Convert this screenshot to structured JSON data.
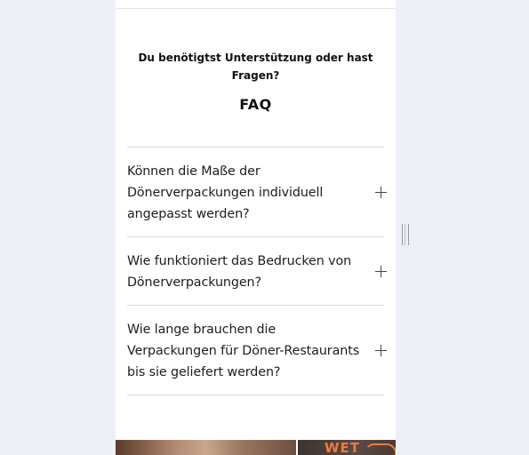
{
  "support": {
    "text": "Du benötigtst Unterstützung oder hast Fragen?"
  },
  "faq": {
    "title": "FAQ",
    "items": [
      {
        "question": "Können die Maße der Dönerverpackungen individuell angepasst werden?",
        "icon": "plus-icon"
      },
      {
        "question": "Wie funktioniert das Bedrucken von Dönerverpackungen?",
        "icon": "plus-icon"
      },
      {
        "question": "Wie lange brauchen die Verpackungen für Döner-Restaurants bis sie geliefert werden?",
        "icon": "plus-icon"
      }
    ]
  },
  "banner": {
    "text": "WET"
  },
  "colors": {
    "page_background": "#eef0f8",
    "content_background": "#ffffff",
    "accent_orange": "#f07a3c"
  }
}
